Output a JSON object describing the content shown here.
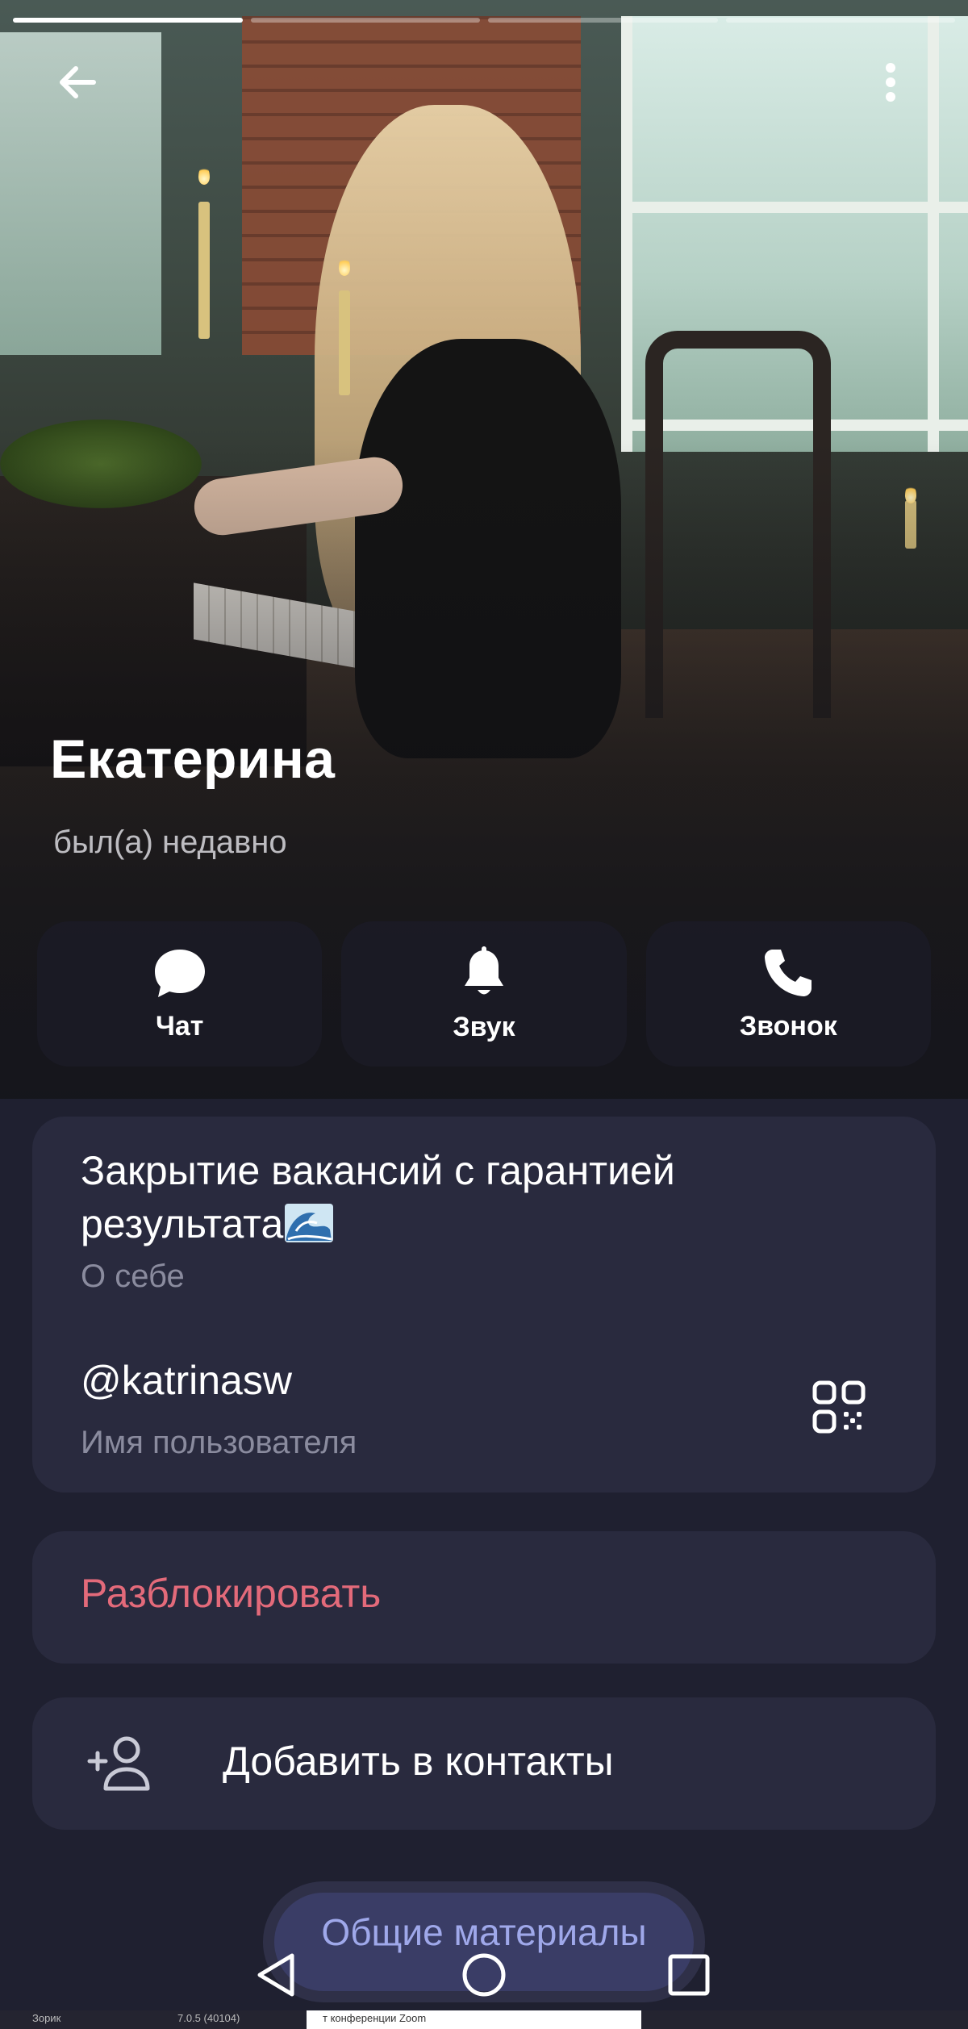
{
  "profile": {
    "name": "Екатерина",
    "status": "был(а) недавно"
  },
  "stories": {
    "count": 4,
    "active_index": 0
  },
  "actions": [
    {
      "label": "Чат",
      "icon": "chat-bubble-icon"
    },
    {
      "label": "Звук",
      "icon": "bell-icon"
    },
    {
      "label": "Звонок",
      "icon": "phone-icon"
    }
  ],
  "info": {
    "bio": "Закрытие вакансий с гарантией результата",
    "bio_emoji": "wave-emoji",
    "bio_caption": "О себе",
    "username": "@katrinasw",
    "username_caption": "Имя пользователя"
  },
  "unblock": {
    "label": "Разблокировать",
    "color": "#e36a7a"
  },
  "add_contact": {
    "label": "Добавить в контакты",
    "icon": "add-person-icon"
  },
  "shared_media": {
    "label": "Общие материалы"
  },
  "colors": {
    "background": "#1f2030",
    "card": "#292a3e",
    "accent_text": "#9fa8ea",
    "caption": "#8a8b9e"
  },
  "bottom_strip": {
    "left_text": "Зорик",
    "middle_text": "7.0.5 (40104)",
    "right_text": "т конференции Zoom"
  }
}
